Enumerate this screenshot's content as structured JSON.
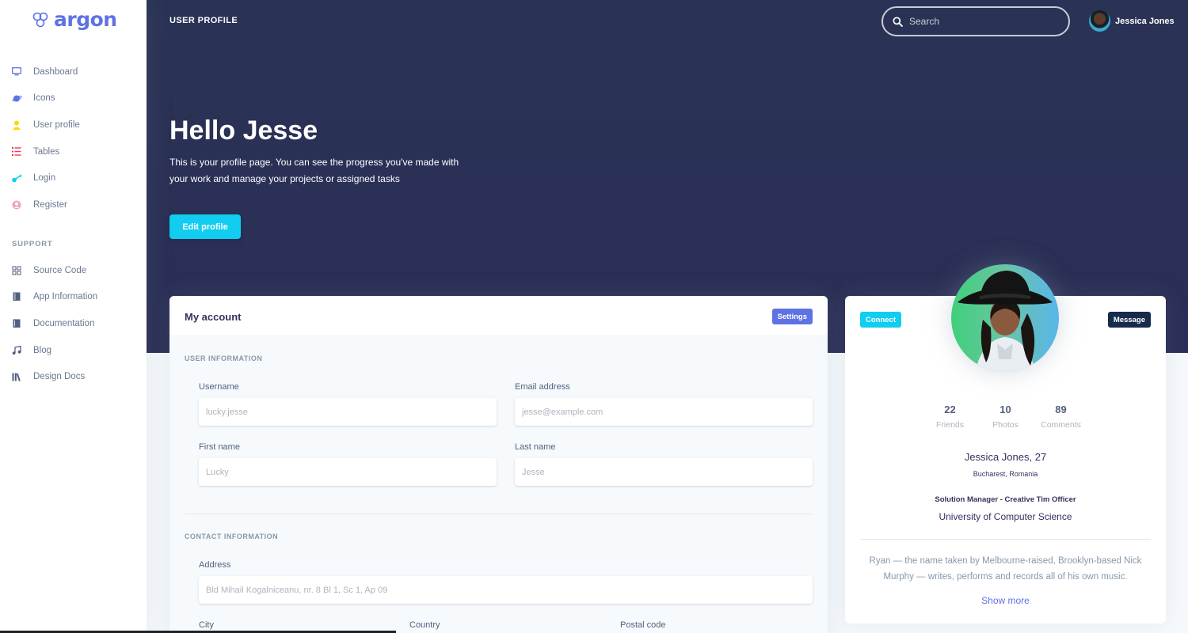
{
  "sidebar": {
    "brand": "argon",
    "nav": [
      {
        "label": "Dashboard",
        "icon": "tv-icon",
        "color": "#5e72e4"
      },
      {
        "label": "Icons",
        "icon": "planet-icon",
        "color": "#5e72e4"
      },
      {
        "label": "User profile",
        "icon": "user-icon",
        "color": "#ffd600"
      },
      {
        "label": "Tables",
        "icon": "list-icon",
        "color": "#f5365c"
      },
      {
        "label": "Login",
        "icon": "key-icon",
        "color": "#11cdef"
      },
      {
        "label": "Register",
        "icon": "circle-user-icon",
        "color": "#f3a4b5"
      }
    ],
    "support_heading": "SUPPORT",
    "support": [
      {
        "label": "Source Code",
        "icon": "code-icon"
      },
      {
        "label": "App Information",
        "icon": "book-icon"
      },
      {
        "label": "Documentation",
        "icon": "doc-icon"
      },
      {
        "label": "Blog",
        "icon": "music-icon"
      },
      {
        "label": "Design Docs",
        "icon": "library-icon"
      }
    ]
  },
  "topbar": {
    "title": "USER PROFILE",
    "search_placeholder": "Search",
    "user_name": "Jessica Jones"
  },
  "hero": {
    "greeting": "Hello Jesse",
    "intro": "This is your profile page. You can see the progress you've made with your work and manage your projects or assigned tasks",
    "edit_label": "Edit profile"
  },
  "account": {
    "title": "My account",
    "settings_label": "Settings",
    "user_section": "USER INFORMATION",
    "contact_section": "CONTACT INFORMATION",
    "username_label": "Username",
    "username_placeholder": "lucky.jesse",
    "email_label": "Email address",
    "email_placeholder": "jesse@example.com",
    "first_label": "First name",
    "first_placeholder": "Lucky",
    "last_label": "Last name",
    "last_placeholder": "Jesse",
    "address_label": "Address",
    "address_placeholder": "Bld Mihail Kogalniceanu, nr. 8 Bl 1, Sc 1, Ap 09",
    "city_label": "City",
    "country_label": "Country",
    "postal_label": "Postal code"
  },
  "profile": {
    "connect_label": "Connect",
    "message_label": "Message",
    "stats": [
      {
        "value": "22",
        "caption": "Friends"
      },
      {
        "value": "10",
        "caption": "Photos"
      },
      {
        "value": "89",
        "caption": "Comments"
      }
    ],
    "name": "Jessica Jones",
    "age": ", 27",
    "location": "Bucharest, Romania",
    "job": "Solution Manager - Creative Tim Officer",
    "university": "University of Computer Science",
    "bio": "Ryan — the name taken by Melbourne-raised, Brooklyn-based Nick Murphy — writes, performs and records all of his own music.",
    "show_more": "Show more"
  },
  "colors": {
    "primary": "#5e72e4",
    "info": "#11cdef",
    "dark": "#172b4d",
    "header_bg": "#2e3558"
  }
}
